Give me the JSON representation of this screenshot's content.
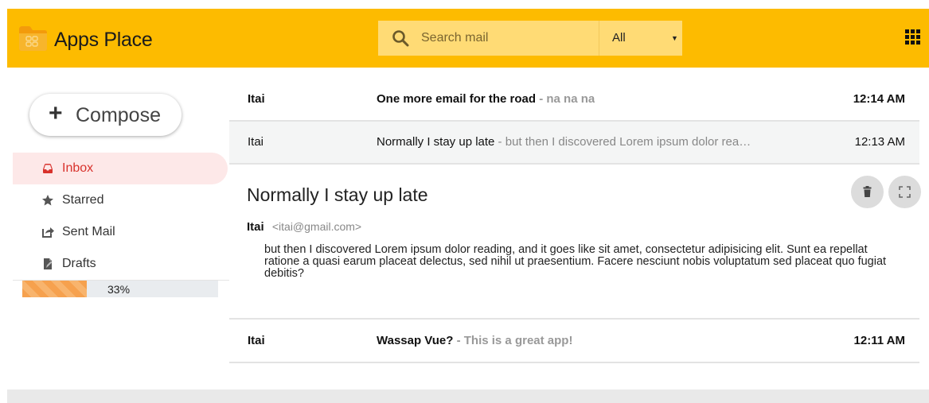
{
  "header": {
    "brand": "Apps Place",
    "search_placeholder": "Search mail",
    "filter_value": "All",
    "accent_color": "#fdbb00"
  },
  "sidebar": {
    "compose_label": "Compose",
    "items": [
      {
        "label": "Inbox",
        "icon": "inbox-icon",
        "active": true
      },
      {
        "label": "Starred",
        "icon": "star-icon"
      },
      {
        "label": "Sent Mail",
        "icon": "sent-icon"
      },
      {
        "label": "Drafts",
        "icon": "drafts-icon"
      }
    ],
    "progress": {
      "value": 0.33,
      "label": "33%"
    }
  },
  "emails": [
    {
      "sender": "Itai",
      "subject": "One more email for the road",
      "snippet": " - na na na",
      "time": "12:14 AM",
      "read": false
    },
    {
      "sender": "Itai",
      "subject": "Normally I stay up late",
      "snippet": " - but then I discovered Lorem ipsum dolor rea…",
      "time": "12:13 AM",
      "read": true
    },
    {
      "sender": "Itai",
      "subject": "Wassap Vue?",
      "snippet": " - This is a great app!",
      "time": "12:11 AM",
      "read": false
    }
  ],
  "open_email": {
    "title": "Normally I stay up late",
    "from_name": "Itai",
    "from_email": "<itai@gmail.com>",
    "body": "but then I discovered Lorem ipsum dolor reading, and it goes like sit amet, consectetur adipisicing elit. Sunt ea repellat ratione a quasi earum placeat delectus, sed nihil ut praesentium. Facere nesciunt nobis voluptatum sed placeat quo fugiat debitis?"
  }
}
